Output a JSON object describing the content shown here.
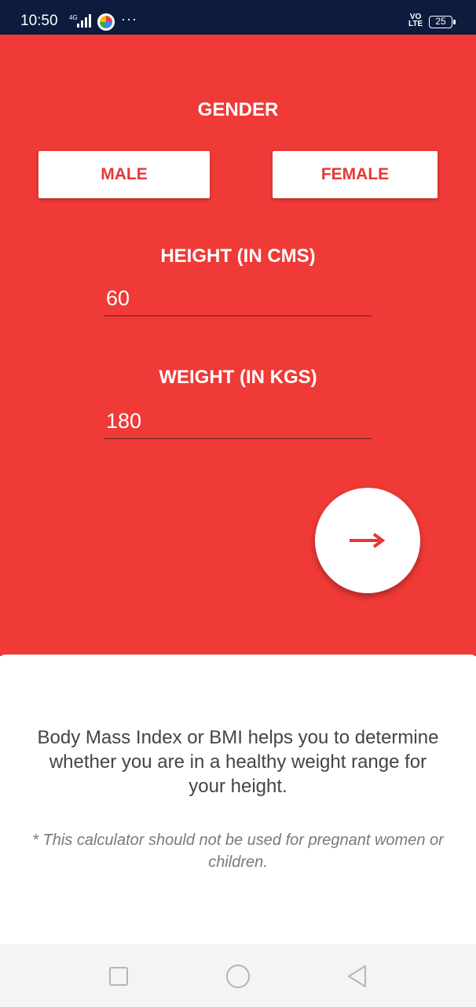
{
  "status_bar": {
    "time": "10:50",
    "network": "4G",
    "volte_line1": "VO",
    "volte_line2": "LTE",
    "battery": "25",
    "overflow_glyph": "···"
  },
  "form": {
    "gender_label": "GENDER",
    "male_label": "MALE",
    "female_label": "FEMALE",
    "height_label": "HEIGHT (IN CMS)",
    "height_value": "60",
    "weight_label": "WEIGHT (IN KGS)",
    "weight_value": "180",
    "next_icon": "arrow-right-icon"
  },
  "info": {
    "description": "Body Mass Index or BMI helps you to determine whether you are in a healthy weight range for your height.",
    "disclaimer": "* This calculator should not be used for pregnant women or children."
  },
  "navigation": {
    "recent_icon": "square-icon",
    "home_icon": "circle-icon",
    "back_icon": "triangle-back-icon"
  },
  "colors": {
    "primary_red": "#ef3a37",
    "accent_red": "#e53935",
    "status_bar": "#0d1b3d"
  }
}
